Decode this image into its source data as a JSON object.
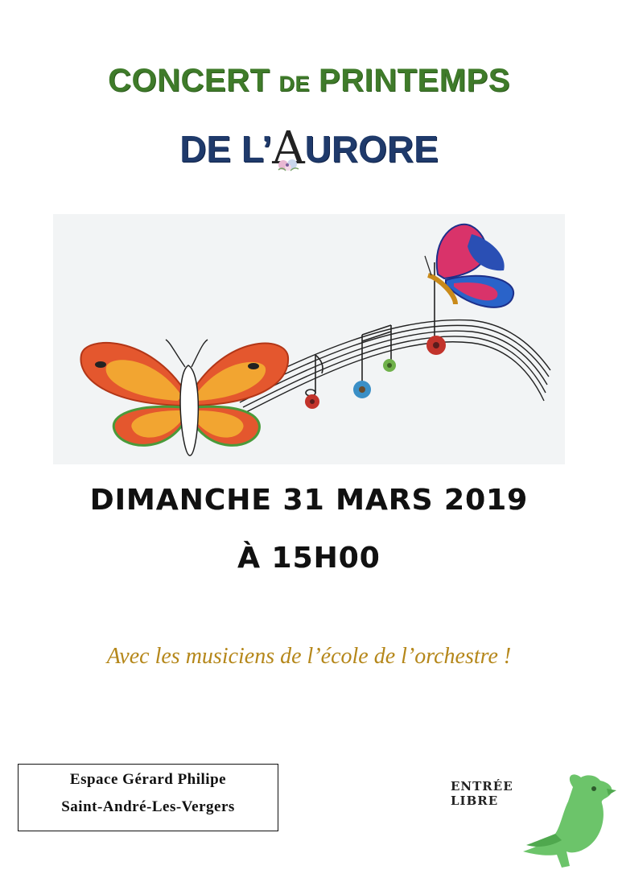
{
  "title": {
    "line1_part1": "CONCERT",
    "line1_part2": "DE",
    "line1_part3": "PRINTEMPS",
    "line2_part1": "DE",
    "line2_part2": "L’",
    "line2_fancy_letter": "A",
    "line2_part3": "URORE"
  },
  "event": {
    "date": "DIMANCHE 31 MARS 2019",
    "time": "À 15H00"
  },
  "subtitle": "Avec les musiciens de l’école de l’orchestre !",
  "venue": {
    "name": "Espace Gérard Philipe",
    "city": "Saint-André-Les-Vergers"
  },
  "admission": "ENTRÉE LIBRE",
  "colors": {
    "title_green": "#3f7b2a",
    "title_blue": "#1f3a6b",
    "subtitle_gold": "#b5871a",
    "bird_green": "#6cc46a"
  },
  "icons": {
    "illustration": "butterfly-music-staff-illustration",
    "decoration": "green-bird-icon"
  }
}
